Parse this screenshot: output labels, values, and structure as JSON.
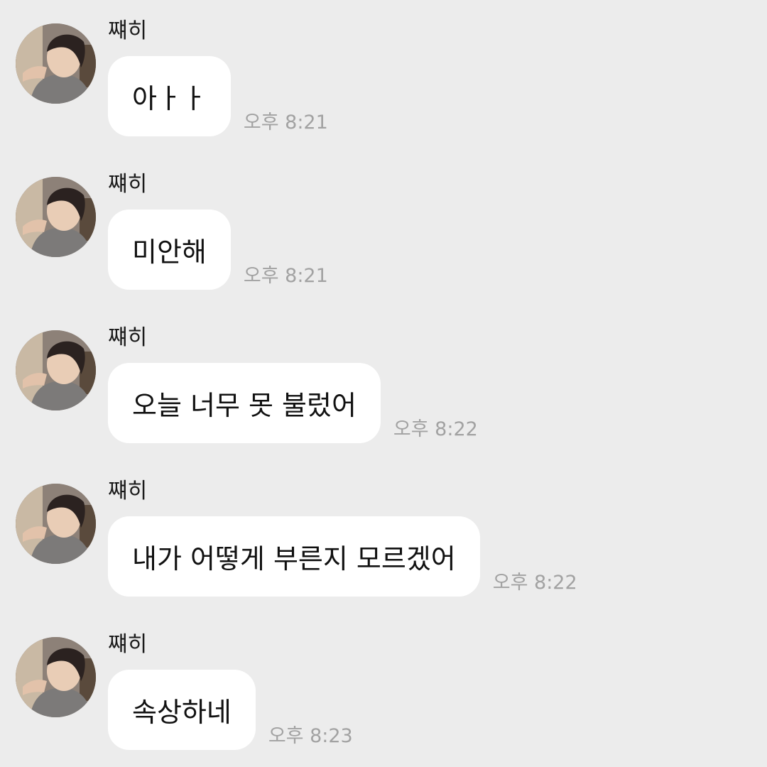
{
  "chat": {
    "messages": [
      {
        "sender": "쨰히",
        "text": "아ㅏㅏ",
        "time": "오후 8:21"
      },
      {
        "sender": "쨰히",
        "text": "미안해",
        "time": "오후 8:21"
      },
      {
        "sender": "쨰히",
        "text": "오늘 너무 못 불렀어",
        "time": "오후 8:22"
      },
      {
        "sender": "쨰히",
        "text": "내가 어떻게 부른지 모르겠어",
        "time": "오후 8:22"
      },
      {
        "sender": "쨰히",
        "text": "속상하네",
        "time": "오후 8:23"
      }
    ]
  },
  "colors": {
    "background": "#ececec",
    "bubble": "#ffffff",
    "timestamp": "#a2a2a2"
  }
}
